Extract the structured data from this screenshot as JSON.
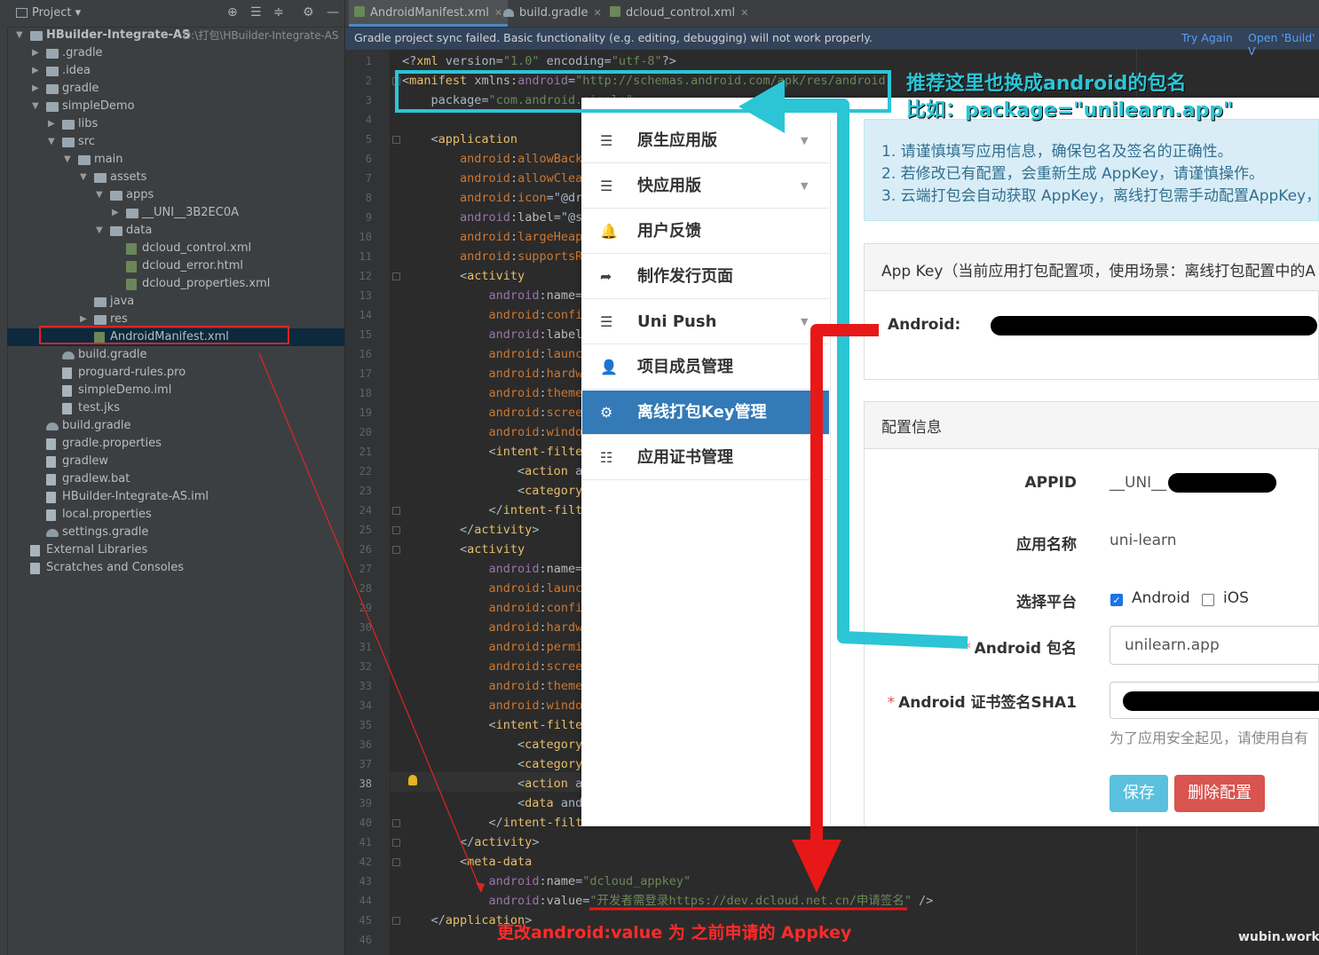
{
  "project_panel": {
    "title": "Project",
    "tree": [
      {
        "label": "HBuilder-Integrate-AS",
        "sub": "D:\\打包\\HBuilder-Integrate-AS",
        "depth": 0,
        "arrow": "down",
        "icon": "folder",
        "bold": true
      },
      {
        "label": ".gradle",
        "depth": 1,
        "arrow": "right",
        "icon": "folder"
      },
      {
        "label": ".idea",
        "depth": 1,
        "arrow": "right",
        "icon": "folder"
      },
      {
        "label": "gradle",
        "depth": 1,
        "arrow": "right",
        "icon": "folder"
      },
      {
        "label": "simpleDemo",
        "depth": 1,
        "arrow": "down",
        "icon": "folder"
      },
      {
        "label": "libs",
        "depth": 2,
        "arrow": "right",
        "icon": "folder"
      },
      {
        "label": "src",
        "depth": 2,
        "arrow": "down",
        "icon": "folder"
      },
      {
        "label": "main",
        "depth": 3,
        "arrow": "down",
        "icon": "folder"
      },
      {
        "label": "assets",
        "depth": 4,
        "arrow": "down",
        "icon": "folder"
      },
      {
        "label": "apps",
        "depth": 5,
        "arrow": "down",
        "icon": "folder"
      },
      {
        "label": "__UNI__3B2EC0A",
        "depth": 6,
        "arrow": "right",
        "icon": "folder"
      },
      {
        "label": "data",
        "depth": 5,
        "arrow": "down",
        "icon": "folder"
      },
      {
        "label": "dcloud_control.xml",
        "depth": 6,
        "arrow": "",
        "icon": "xml"
      },
      {
        "label": "dcloud_error.html",
        "depth": 6,
        "arrow": "",
        "icon": "xml"
      },
      {
        "label": "dcloud_properties.xml",
        "depth": 6,
        "arrow": "",
        "icon": "xml"
      },
      {
        "label": "java",
        "depth": 4,
        "arrow": "",
        "icon": "folder"
      },
      {
        "label": "res",
        "depth": 4,
        "arrow": "right",
        "icon": "folder"
      },
      {
        "label": "AndroidManifest.xml",
        "depth": 4,
        "arrow": "",
        "icon": "xml",
        "selected": true
      },
      {
        "label": "build.gradle",
        "depth": 2,
        "arrow": "",
        "icon": "gradle"
      },
      {
        "label": "proguard-rules.pro",
        "depth": 2,
        "arrow": "",
        "icon": "file"
      },
      {
        "label": "simpleDemo.iml",
        "depth": 2,
        "arrow": "",
        "icon": "file"
      },
      {
        "label": "test.jks",
        "depth": 2,
        "arrow": "",
        "icon": "file"
      },
      {
        "label": "build.gradle",
        "depth": 1,
        "arrow": "",
        "icon": "gradle"
      },
      {
        "label": "gradle.properties",
        "depth": 1,
        "arrow": "",
        "icon": "file"
      },
      {
        "label": "gradlew",
        "depth": 1,
        "arrow": "",
        "icon": "file"
      },
      {
        "label": "gradlew.bat",
        "depth": 1,
        "arrow": "",
        "icon": "file"
      },
      {
        "label": "HBuilder-Integrate-AS.iml",
        "depth": 1,
        "arrow": "",
        "icon": "file"
      },
      {
        "label": "local.properties",
        "depth": 1,
        "arrow": "",
        "icon": "file"
      },
      {
        "label": "settings.gradle",
        "depth": 1,
        "arrow": "",
        "icon": "gradle"
      },
      {
        "label": "External Libraries",
        "depth": 0,
        "arrow": "",
        "icon": "file"
      },
      {
        "label": "Scratches and Consoles",
        "depth": 0,
        "arrow": "",
        "icon": "file"
      }
    ]
  },
  "editor": {
    "tabs": [
      {
        "label": "AndroidManifest.xml",
        "active": true
      },
      {
        "label": "build.gradle",
        "active": false
      },
      {
        "label": "dcloud_control.xml",
        "active": false
      }
    ],
    "notification": {
      "message": "Gradle project sync failed. Basic functionality (e.g. editing, debugging) will not work properly.",
      "try_again": "Try Again",
      "open_build": "Open 'Build' V"
    },
    "current_line": 38,
    "lines": [
      "1|<?xml version=\"1.0\" encoding=\"utf-8\"?>",
      "2|<manifest xmlns:android=\"http://schemas.android.com/apk/res/android\"",
      "3|    package=\"com.android.simple\">",
      "4|",
      "5|    <application",
      "6|        android:allowBack",
      "7|        android:allowClea",
      "8|        android:icon=\"@dr",
      "9|        android:label=\"@st",
      "10|        android:largeHeap",
      "11|        android:supportsR",
      "12|        <activity",
      "13|            android:name=",
      "14|            android:confi",
      "15|            android:label",
      "16|            android:launc",
      "17|            android:hardw",
      "18|            android:theme",
      "19|            android:scree",
      "20|            android:windo",
      "21|            <intent-filte",
      "22|                <action a",
      "23|                <category",
      "24|            </intent-filt",
      "25|        </activity>",
      "26|        <activity",
      "27|            android:name=",
      "28|            android:launc",
      "29|            android:confi",
      "30|            android:hardw",
      "31|            android:permi",
      "32|            android:scree",
      "33|            android:theme",
      "34|            android:windo",
      "35|            <intent-filte",
      "36|                <category",
      "37|                <category",
      "38|                <action a",
      "39|                <data and",
      "40|            </intent-filt",
      "41|        </activity>",
      "42|        <meta-data",
      "43|            android:name=\"dcloud_appkey\"",
      "44|            android:value=\"开发者需登录https://dev.dcloud.net.cn/申请签名\" />",
      "45|    </application>",
      "46|"
    ]
  },
  "overlay": {
    "menu": [
      {
        "icon": "list-icon",
        "glyph": "☰",
        "label": "原生应用版",
        "caret": true,
        "active": false
      },
      {
        "icon": "list-icon",
        "glyph": "☰",
        "label": "快应用版",
        "caret": true,
        "active": false
      },
      {
        "icon": "bell-icon",
        "glyph": "🔔",
        "label": "用户反馈",
        "caret": false,
        "active": false
      },
      {
        "icon": "share-icon",
        "glyph": "➦",
        "label": "制作发行页面",
        "caret": false,
        "active": false
      },
      {
        "icon": "list-icon",
        "glyph": "☰",
        "label": "Uni Push",
        "caret": true,
        "active": false
      },
      {
        "icon": "user-icon",
        "glyph": "👤",
        "label": "项目成员管理",
        "caret": false,
        "active": false
      },
      {
        "icon": "gear-icon",
        "glyph": "⚙",
        "label": "离线打包Key管理",
        "caret": false,
        "active": true
      },
      {
        "icon": "list-icon",
        "glyph": "☷",
        "label": "应用证书管理",
        "caret": false,
        "active": false
      }
    ],
    "notice": [
      "1. 请谨慎填写应用信息，确保包名及签名的正确性。",
      "2. 若修改已有配置，会重新生成 AppKey，请谨慎操作。",
      "3. 云端打包会自动获取 AppKey，离线打包需手动配置AppKey，"
    ],
    "appkey_title": "App Key（当前应用打包配置项，使用场景：离线打包配置中的A",
    "android_key_label": "Android:",
    "config_title": "配置信息",
    "form": {
      "appid_label": "APPID",
      "appid_value": "__UNI__",
      "app_name_label": "应用名称",
      "app_name_value": "uni-learn",
      "platform_label": "选择平台",
      "platform_android": "Android",
      "platform_ios": "iOS",
      "android_checked": true,
      "ios_checked": false,
      "package_label": "Android 包名",
      "package_value": "unilearn.app",
      "sha1_label": "Android 证书签名SHA1",
      "sha1_hint": "为了应用安全起见，请使用自有",
      "save": "保存",
      "delete": "删除配置"
    }
  },
  "annotations": {
    "cyan_line1": "推荐这里也换成android的包名",
    "cyan_line2": "比如：package=\"unilearn.app\"",
    "red": "更改android:value 为 之前申请的 Appkey",
    "watermark": "wubin.work"
  },
  "colors": {
    "annotation_cyan": "#2bc5d6",
    "annotation_red": "#e81818",
    "menu_active": "#337ab7",
    "save_button": "#5bc0de",
    "delete_button": "#d9534f"
  }
}
